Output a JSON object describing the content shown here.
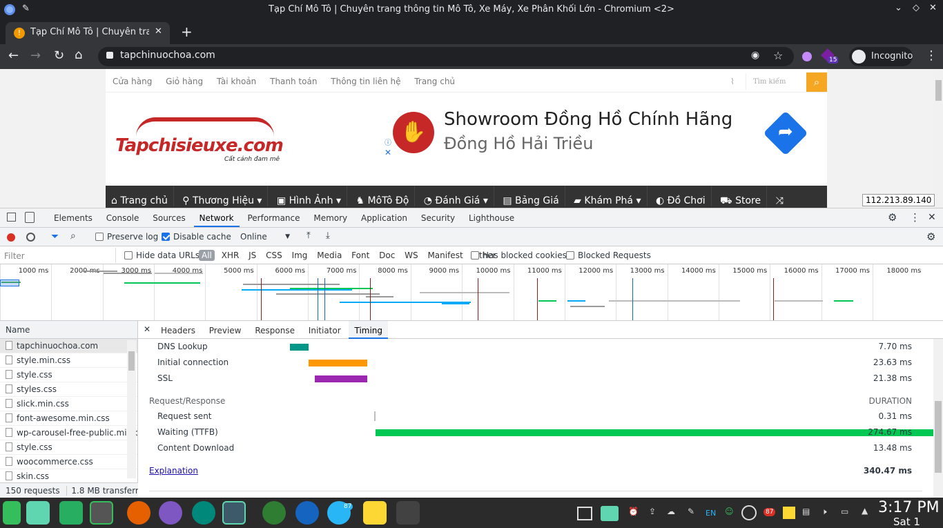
{
  "window": {
    "title": "Tạp Chí Mô Tô | Chuyên trang thông tin Mô Tô, Xe Máy, Xe Phân Khối Lớn - Chromium <2>"
  },
  "tab": {
    "title": "Tạp Chí Mô Tô | Chuyên trang",
    "new_tab": "+"
  },
  "omnibox": {
    "url": "tapchinuochoa.com",
    "extension_badge": "15",
    "profile": "Incognito"
  },
  "site": {
    "topnav": [
      "Cửa hàng",
      "Giỏ hàng",
      "Tài khoản",
      "Thanh toán",
      "Thông tin liên hệ",
      "Trang chủ"
    ],
    "search_placeholder": "Tìm kiếm",
    "logo_text": "Tapchisieuxe.com",
    "logo_slogan": "Cất cánh đam mê",
    "ad_title": "Showroom Đồng Hồ Chính Hãng",
    "ad_subtitle": "Đồng Hồ Hải Triều",
    "mainnav": [
      "Trang chủ",
      "Thương Hiệu",
      "Hình Ảnh",
      "MôTô Độ",
      "Đánh Giá",
      "Bảng Giá",
      "Khám Phá",
      "Đồ Chơi",
      "Store"
    ],
    "ip_tooltip": "112.213.89.140"
  },
  "devtools": {
    "tabs": [
      "Elements",
      "Console",
      "Sources",
      "Network",
      "Performance",
      "Memory",
      "Application",
      "Security",
      "Lighthouse"
    ],
    "active_tab": "Network",
    "preserve_log": "Preserve log",
    "disable_cache": "Disable cache",
    "throttle": "Online",
    "filter_placeholder": "Filter",
    "hide_data_urls": "Hide data URLs",
    "types": [
      "All",
      "XHR",
      "JS",
      "CSS",
      "Img",
      "Media",
      "Font",
      "Doc",
      "WS",
      "Manifest",
      "Other"
    ],
    "has_blocked_cookies": "Has blocked cookies",
    "blocked_requests": "Blocked Requests",
    "overview_ticks": [
      "1000 ms",
      "2000 ms",
      "3000 ms",
      "4000 ms",
      "5000 ms",
      "6000 ms",
      "7000 ms",
      "8000 ms",
      "9000 ms",
      "10000 ms",
      "11000 ms",
      "12000 ms",
      "13000 ms",
      "14000 ms",
      "15000 ms",
      "16000 ms",
      "17000 ms",
      "18000 ms"
    ],
    "name_header": "Name",
    "files": [
      "tapchinuochoa.com",
      "style.min.css",
      "style.css",
      "styles.css",
      "slick.min.css",
      "font-awesome.min.css",
      "wp-carousel-free-public.min.css",
      "style.css",
      "woocommerce.css",
      "skin.css"
    ],
    "detail_tabs": [
      "Headers",
      "Preview",
      "Response",
      "Initiator",
      "Timing"
    ],
    "active_detail_tab": "Timing",
    "timing_rows_top": [
      {
        "label": "DNS Lookup",
        "value": "7.70 ms",
        "color": "#009688",
        "start": 0.0,
        "width": 0.027
      },
      {
        "label": "Initial connection",
        "value": "23.63 ms",
        "color": "#ff9800",
        "start": 0.027,
        "width": 0.085
      },
      {
        "label": "SSL",
        "value": "21.38 ms",
        "color": "#9c27b0",
        "start": 0.036,
        "width": 0.076
      }
    ],
    "section_title": "Request/Response",
    "duration_label": "DURATION",
    "timing_rows_bottom": [
      {
        "label": "Request sent",
        "value": "0.31 ms",
        "color": "#bdbdbd",
        "start": 0.122,
        "width": 0.002
      },
      {
        "label": "Waiting (TTFB)",
        "value": "274.67 ms",
        "color": "#00c853",
        "start": 0.124,
        "width": 0.826
      },
      {
        "label": "Content Download",
        "value": "13.48 ms",
        "color": "#03a9f4",
        "start": 0.95,
        "width": 0.04
      }
    ],
    "explanation": "Explanation",
    "total": "340.47 ms",
    "status_requests": "150 requests",
    "status_transferred": "1.8 MB transferred"
  },
  "taskbar": {
    "telegram_badge": "87",
    "tray_badge": "87",
    "lang": "EN",
    "time": "3:17 PM",
    "day": "Sat 1"
  }
}
